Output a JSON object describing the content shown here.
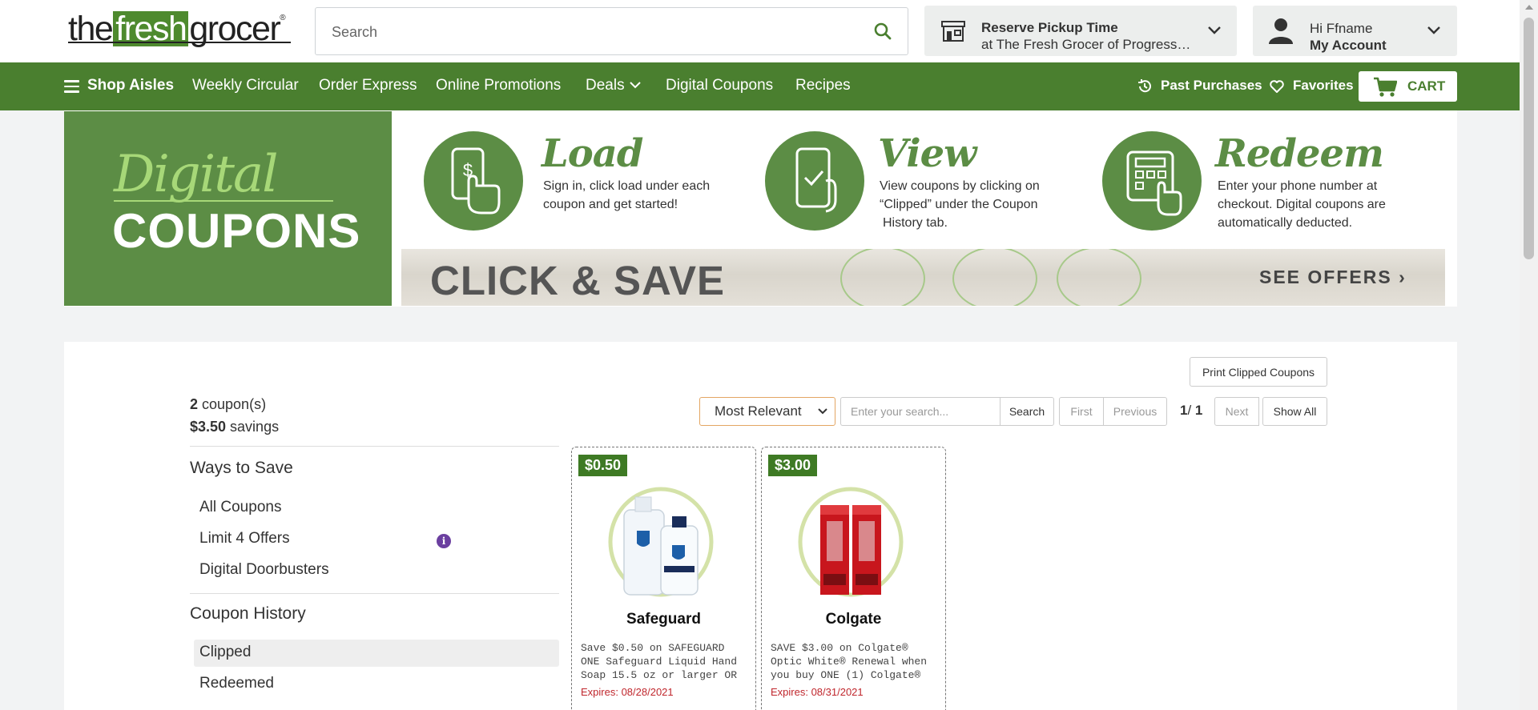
{
  "brand": {
    "logo_part1": "the",
    "logo_part2": "fresh",
    "logo_part3": "grocer",
    "logo_mark": "®",
    "accent": "#4a7f2f"
  },
  "header": {
    "search_placeholder": "Search",
    "pickup": {
      "title": "Reserve Pickup Time",
      "subtitle": "at The Fresh Grocer of Progress Plaza"
    },
    "account": {
      "greeting": "Hi Ffname",
      "label": "My Account"
    }
  },
  "nav": {
    "shop_aisles": "Shop Aisles",
    "weekly_circular": "Weekly Circular",
    "order_express": "Order Express",
    "online_promotions": "Online Promotions",
    "deals": "Deals",
    "digital_coupons": "Digital Coupons",
    "recipes": "Recipes",
    "past_purchases": "Past Purchases",
    "favorites": "Favorites",
    "cart": "CART"
  },
  "banner": {
    "digital": "Digital",
    "coupons": "COUPONS",
    "steps": [
      {
        "title": "Load",
        "desc": [
          "Sign in, click load under each",
          "coupon and get started!"
        ]
      },
      {
        "title": "View",
        "desc": [
          "View coupons by clicking on",
          "“Clipped” under the Coupon",
          "History tab."
        ]
      },
      {
        "title": "Redeem",
        "desc": [
          "Enter your phone number at",
          "checkout. Digital coupons are",
          "automatically deducted."
        ]
      }
    ],
    "click_save": "CLICK & SAVE",
    "see_offers": "SEE OFFERS ›"
  },
  "toolbar": {
    "print_label": "Print Clipped Coupons",
    "coupon_count": "2",
    "coupon_count_suffix": " coupon(s)",
    "savings_amount": "$3.50",
    "savings_suffix": " savings",
    "sort_selected": "Most Relevant",
    "search_placeholder": "Enter your search...",
    "search_button": "Search",
    "first": "First",
    "previous": "Previous",
    "page_current": "1",
    "page_sep": "/ ",
    "page_total": "1",
    "next": "Next",
    "show_all": "Show All"
  },
  "sidebar": {
    "ways_heading": "Ways to Save",
    "ways": [
      "All Coupons",
      "Limit 4 Offers",
      "Digital Doorbusters"
    ],
    "info_glyph": "i",
    "history_heading": "Coupon History",
    "history": [
      "Clipped",
      "Redeemed"
    ]
  },
  "coupons": [
    {
      "price": "$0.50",
      "brand": "Safeguard",
      "desc": "Save $0.50 on SAFEGUARD ONE Safeguard Liquid Hand Soap 15.5 oz or larger OR Safeguard Hand Sanitizer",
      "expires": "Expires: 08/28/2021"
    },
    {
      "price": "$3.00",
      "brand": "Colgate",
      "desc": "SAVE $3.00 on Colgate® Optic White® Renewal when you buy ONE (1) Colgate® Optic White® Renewal Toothpaste",
      "expires": "Expires: 08/31/2021"
    }
  ]
}
